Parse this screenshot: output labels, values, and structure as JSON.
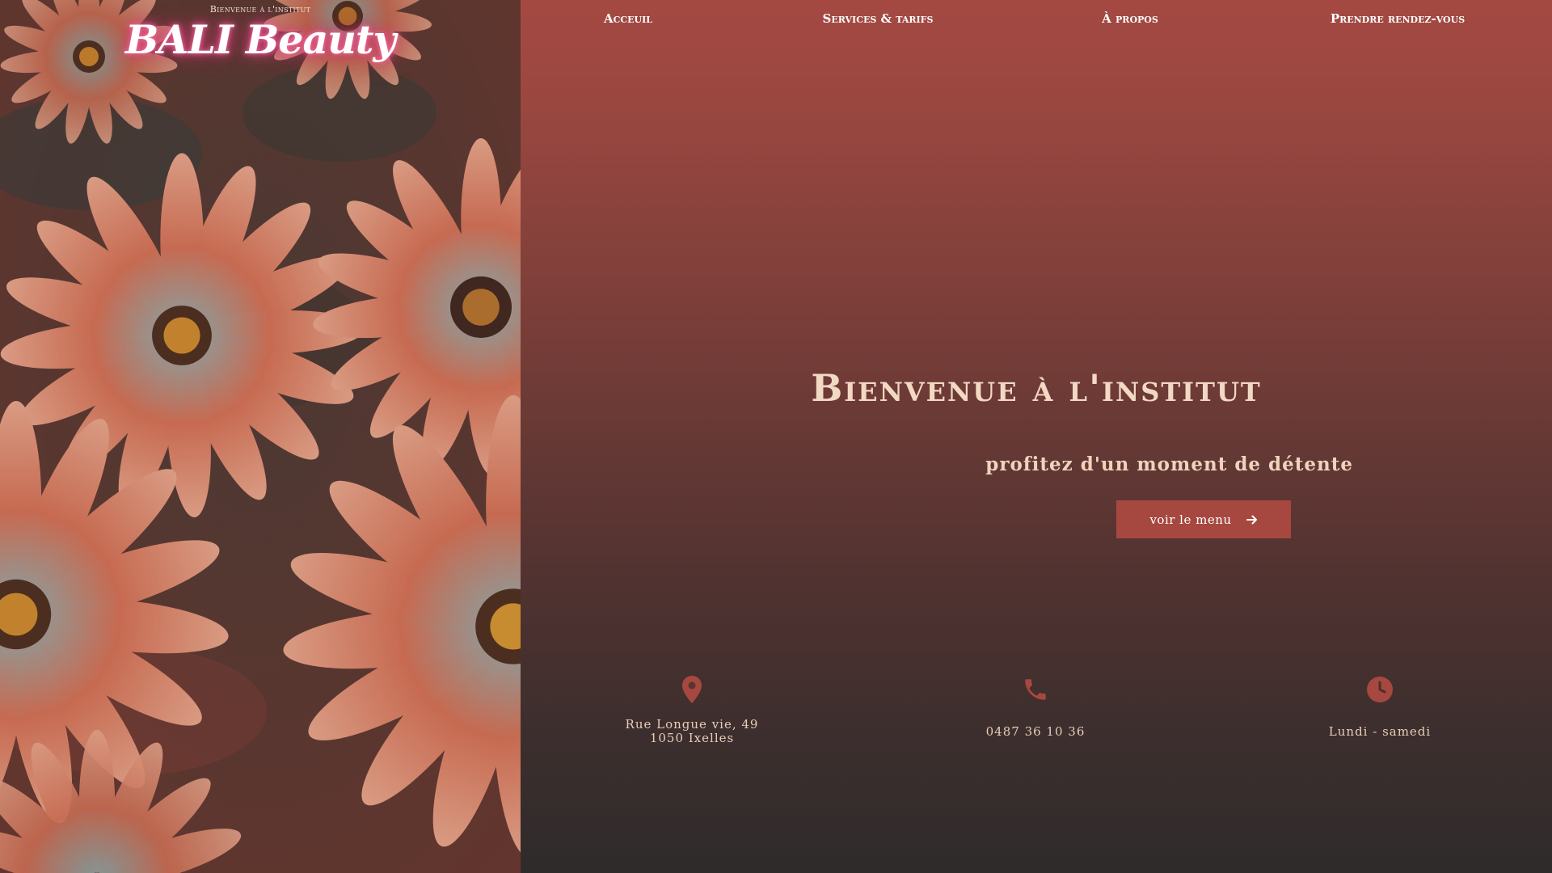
{
  "brand": {
    "kicker": "Bienvenue à l'institut",
    "logo": "BALI Beauty"
  },
  "nav": {
    "items": [
      {
        "label": "Acceuil"
      },
      {
        "label": "Services & tarifs"
      },
      {
        "label": "À propos"
      },
      {
        "label": "Prendre rendez-vous"
      }
    ]
  },
  "hero": {
    "title": "Bienvenue à l'institut",
    "subtitle": "profitez d'un moment de détente",
    "cta_label": "voir le menu",
    "cta_icon": "arrow-right-icon"
  },
  "contact": {
    "address": {
      "icon": "map-pin-icon",
      "line1": "Rue Longue vie, 49",
      "line2": "1050 Ixelles"
    },
    "phone": {
      "icon": "phone-icon",
      "text": "0487 36 10 36"
    },
    "hours": {
      "icon": "clock-icon",
      "text": "Lundi - samedi"
    }
  },
  "colors": {
    "accent": "#a6483f",
    "hero_top": "#a44942",
    "hero_bottom": "#2f2b2b",
    "text_warm": "#f2d9c4",
    "logo_glow": "#e0457f"
  }
}
